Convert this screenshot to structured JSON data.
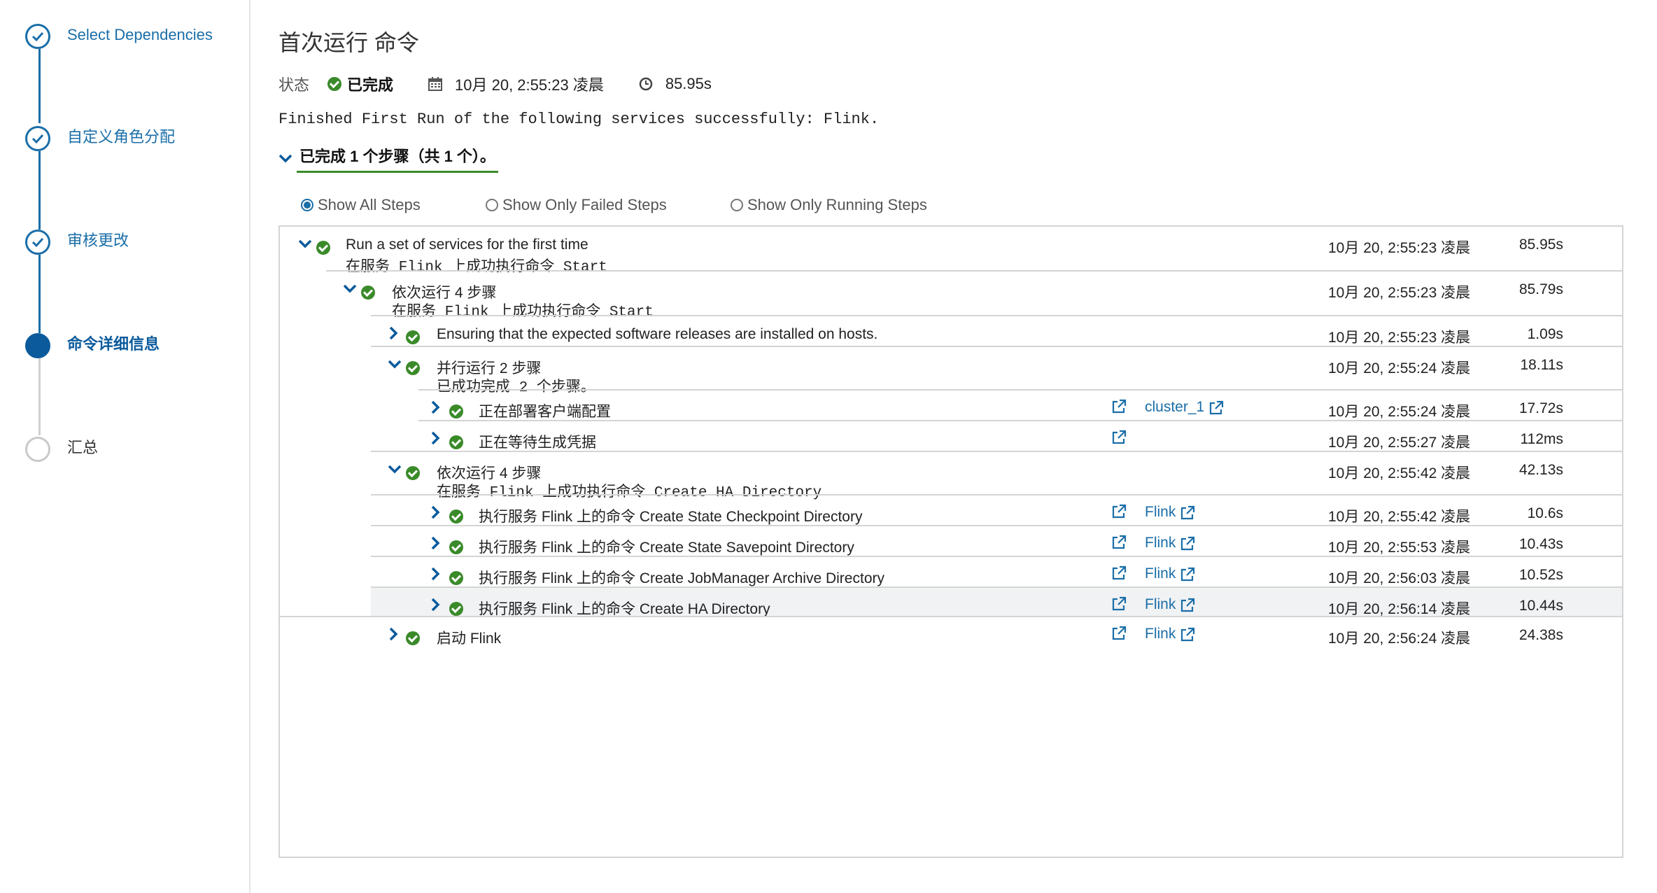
{
  "sidebar": {
    "steps": [
      {
        "label": "Select Dependencies",
        "state": "done"
      },
      {
        "label": "自定义角色分配",
        "state": "done"
      },
      {
        "label": "审核更改",
        "state": "done"
      },
      {
        "label": "命令详细信息",
        "state": "active"
      },
      {
        "label": "汇总",
        "state": "todo"
      }
    ]
  },
  "colors": {
    "accent": "#1a6ea8",
    "active_step": "#0a5a9c",
    "success": "#3a8a2a",
    "row_highlight": "#f1f2f4"
  },
  "header": {
    "title": "首次运行 命令",
    "status_label": "状态",
    "status_value": "已完成",
    "started": "10月 20, 2:55:23 凌晨",
    "duration": "85.95s",
    "message": "Finished First Run of the following services successfully: Flink.",
    "summary": "已完成 1 个步骤（共 1 个）。"
  },
  "filters": {
    "options": [
      "Show All Steps",
      "Show Only Failed Steps",
      "Show Only Running Steps"
    ],
    "selected": "Show All Steps"
  },
  "steps": [
    {
      "title": "Run a set of services for the first time",
      "subtitle": "在服务 Flink 上成功执行命令 Start",
      "time": "10月 20, 2:55:23 凌晨",
      "duration": "85.95s",
      "expanded": true,
      "level": 0
    },
    {
      "title": "依次运行 4 步骤",
      "subtitle": "在服务 Flink 上成功执行命令 Start",
      "time": "10月 20, 2:55:23 凌晨",
      "duration": "85.79s",
      "expanded": true,
      "level": 1
    },
    {
      "title": "Ensuring that the expected software releases are installed on hosts.",
      "subtitle": "",
      "time": "10月 20, 2:55:23 凌晨",
      "duration": "1.09s",
      "expanded": false,
      "level": 2
    },
    {
      "title": "并行运行 2 步骤",
      "subtitle": "已成功完成 2 个步骤。",
      "time": "10月 20, 2:55:24 凌晨",
      "duration": "18.11s",
      "expanded": true,
      "level": 2
    },
    {
      "title": "正在部署客户端配置",
      "subtitle": "",
      "target": "cluster_1",
      "time": "10月 20, 2:55:24 凌晨",
      "duration": "17.72s",
      "expanded": false,
      "level": 3
    },
    {
      "title": "正在等待生成凭据",
      "subtitle": "",
      "target": "",
      "time": "10月 20, 2:55:27 凌晨",
      "duration": "112ms",
      "expanded": false,
      "level": 3
    },
    {
      "title": "依次运行 4 步骤",
      "subtitle": "在服务 Flink 上成功执行命令 Create HA Directory",
      "time": "10月 20, 2:55:42 凌晨",
      "duration": "42.13s",
      "expanded": true,
      "level": 2
    },
    {
      "title": "执行服务 Flink 上的命令 Create State Checkpoint Directory",
      "subtitle": "",
      "target": "Flink",
      "time": "10月 20, 2:55:42 凌晨",
      "duration": "10.6s",
      "expanded": false,
      "level": 3
    },
    {
      "title": "执行服务 Flink 上的命令 Create State Savepoint Directory",
      "subtitle": "",
      "target": "Flink",
      "time": "10月 20, 2:55:53 凌晨",
      "duration": "10.43s",
      "expanded": false,
      "level": 3
    },
    {
      "title": "执行服务 Flink 上的命令 Create JobManager Archive Directory",
      "subtitle": "",
      "target": "Flink",
      "time": "10月 20, 2:56:03 凌晨",
      "duration": "10.52s",
      "expanded": false,
      "level": 3
    },
    {
      "title": "执行服务 Flink 上的命令 Create HA Directory",
      "subtitle": "",
      "target": "Flink",
      "time": "10月 20, 2:56:14 凌晨",
      "duration": "10.44s",
      "expanded": false,
      "level": 3,
      "highlighted": true
    },
    {
      "title": "启动 Flink",
      "subtitle": "",
      "target": "Flink",
      "time": "10月 20, 2:56:24 凌晨",
      "duration": "24.38s",
      "expanded": false,
      "level": 2
    }
  ]
}
